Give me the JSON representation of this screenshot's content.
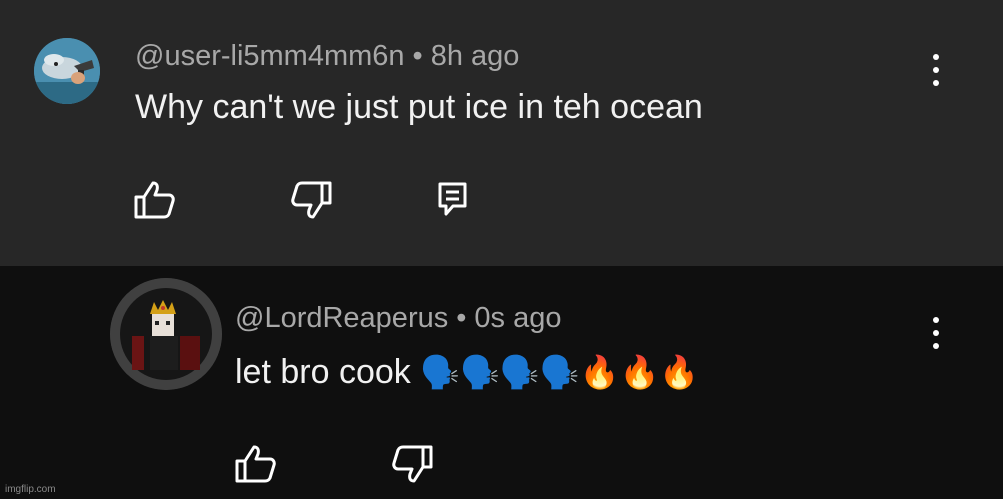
{
  "comments": [
    {
      "username": "@user-li5mm4mm6n",
      "separator": "•",
      "time": "8h ago",
      "text": "Why can't we just put ice in teh ocean",
      "avatar_icon": "dolphin-gun-avatar-icon",
      "actions": [
        "like-icon",
        "dislike-icon",
        "reply-icon"
      ],
      "background": "#272727"
    },
    {
      "username": "@LordReaperus",
      "separator": "•",
      "time": "0s ago",
      "text": "let bro cook",
      "emojis": "🗣️🗣️🗣️🗣️🔥🔥🔥",
      "avatar_icon": "crowned-figure-avatar-icon",
      "actions": [
        "like-icon",
        "dislike-icon"
      ],
      "background": "#0f0f0f"
    }
  ],
  "watermark": "imgflip.com"
}
